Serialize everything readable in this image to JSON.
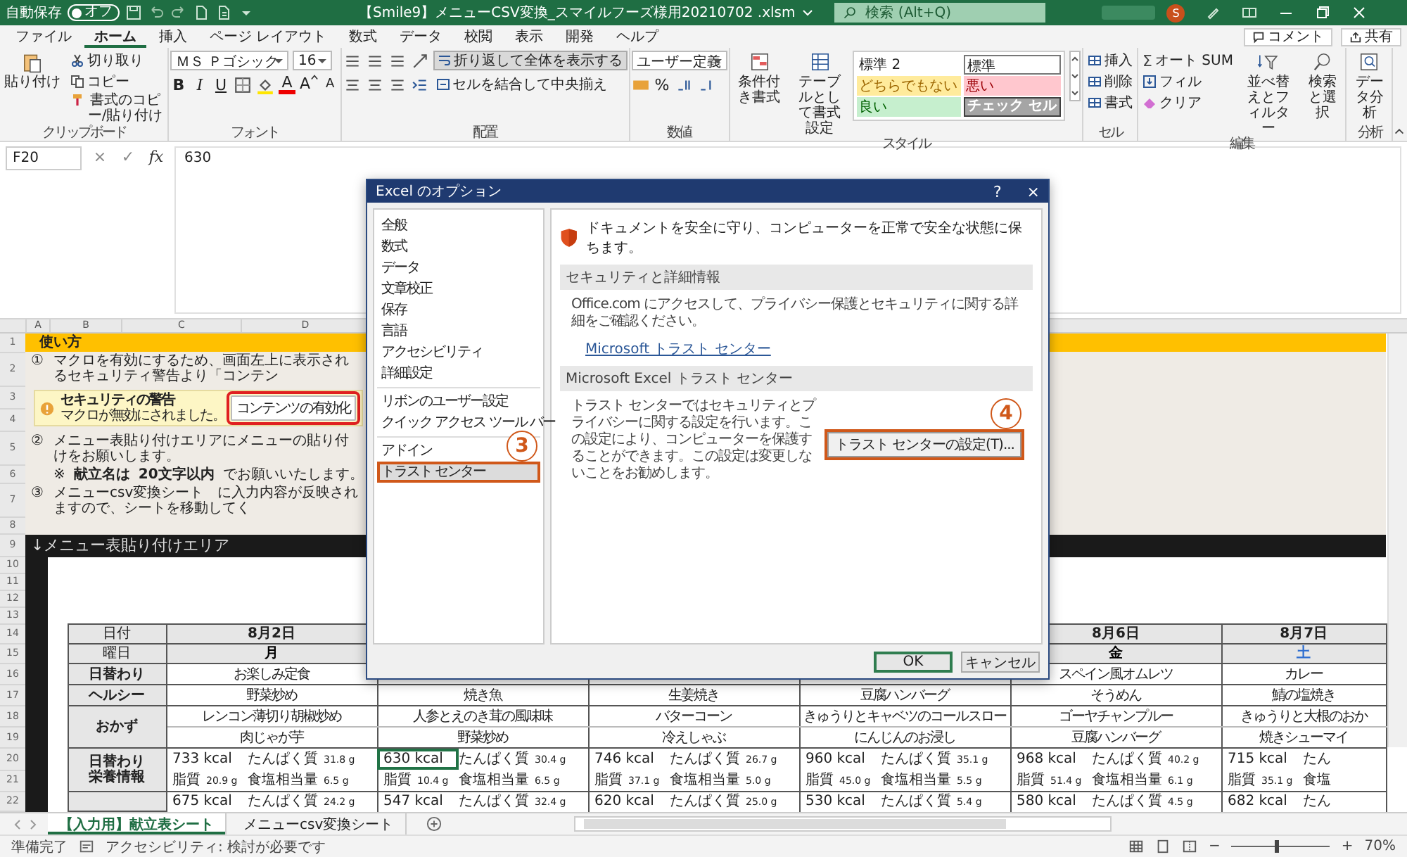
{
  "titlebar": {
    "autosave": "自動保存",
    "autosave_on": false,
    "toggle": "オフ",
    "title": "【Smile9】メニューCSV変換_スマイルフーズ様用20210702 .xlsm",
    "search": "検索 (Alt+Q)",
    "avatar": "S"
  },
  "menu": {
    "tabs": [
      {
        "label": "ファイル",
        "selected": false
      },
      {
        "label": "ホーム",
        "selected": true
      },
      {
        "label": "挿入",
        "selected": false
      },
      {
        "label": "ページ レイアウト",
        "selected": false
      },
      {
        "label": "数式",
        "selected": false
      },
      {
        "label": "データ",
        "selected": false
      },
      {
        "label": "校閲",
        "selected": false
      },
      {
        "label": "表示",
        "selected": false
      },
      {
        "label": "開発",
        "selected": false
      },
      {
        "label": "ヘルプ",
        "selected": false
      }
    ],
    "comment": "コメント",
    "share": "共有"
  },
  "ribbon": {
    "clipboard": {
      "paste": "貼り付け",
      "cut": "切り取り",
      "copy": "コピー",
      "painter": "書式のコピー/貼り付け",
      "label": "クリップボード"
    },
    "font": {
      "name": "ＭＳ Ｐゴシック",
      "size": "16",
      "grow": "A",
      "shrink": "A",
      "bold": "B",
      "italic": "I",
      "underline": "U",
      "color_letter": "A",
      "label": "フォント"
    },
    "alignment": {
      "wrap": "折り返して全体を表示する",
      "wrap_on": true,
      "merge": "セルを結合して中央揃え",
      "label": "配置"
    },
    "number": {
      "format": "ユーザー定義",
      "percent": "%",
      "label": "数値"
    },
    "styles": {
      "conditional": "条件付き書式",
      "table": "テーブルとして書式設定",
      "gallery": [
        {
          "name": "標準 2",
          "kind": "plain"
        },
        {
          "name": "標準",
          "kind": "outlined"
        },
        {
          "name": "どちらでもない",
          "kind": "neutral"
        },
        {
          "name": "悪い",
          "kind": "bad"
        },
        {
          "name": "良い",
          "kind": "good"
        },
        {
          "name": "チェック セル",
          "kind": "check"
        }
      ],
      "label": "スタイル"
    },
    "cells": {
      "buttons": [
        "挿入",
        "削除",
        "書式"
      ],
      "label": "セル"
    },
    "editing": {
      "sigma": "Σ",
      "autosum": "オート SUM",
      "fill": "フィル",
      "clear": "クリア",
      "sort": "並べ替えとフィルター",
      "find": "検索と選択",
      "label": "編集"
    },
    "analysis": {
      "button": "データ分析",
      "label": "分析"
    }
  },
  "formula": {
    "cell": "F20",
    "cancel": "×",
    "enter": "✓",
    "fx": "fx",
    "value": "630"
  },
  "sheet": {
    "columns": [
      "A",
      "B",
      "C",
      "D"
    ],
    "row_numbers": [
      "1",
      "2",
      "3",
      "4",
      "5",
      "6",
      "7",
      "8",
      "9",
      "10",
      "11",
      "12",
      "13",
      "14",
      "15",
      "16",
      "17",
      "18",
      "19",
      "20",
      "21",
      "22"
    ],
    "howto": "使い方",
    "steps": [
      {
        "number": "①",
        "text": "マクロを有効にするため、画面左上に表示されるセキュリティ警告より「コンテン"
      },
      {
        "number": "②",
        "text": "メニュー表貼り付けエリアにメニューの貼り付けをお願いします。"
      },
      {
        "number": "③",
        "text": "メニューcsv変換シート　に入力内容が反映されますので、シートを移動してく"
      }
    ],
    "note": [
      {
        "text": "※",
        "bold": false
      },
      {
        "text": "献立名は",
        "bold": true
      },
      {
        "text": "20文字以内",
        "bold": true
      },
      {
        "text": "でお願いいたします。",
        "bold": false
      }
    ],
    "security": {
      "title": "セキュリティの警告",
      "message": "マクロが無効にされました。",
      "button": "コンテンツの有効化",
      "highlighted": true
    },
    "paste_area": "↓メニュー表貼り付けエリア"
  },
  "table": {
    "date_row": {
      "label": "日付",
      "cells": [
        "8月2日",
        null,
        null,
        null,
        "8月6日",
        "8月7日"
      ]
    },
    "weekday_row": {
      "label": "曜日",
      "cells": [
        {
          "text": "月",
          "color": "#000000"
        },
        null,
        null,
        null,
        {
          "text": "金",
          "color": "#000000"
        },
        {
          "text": "土",
          "color": "#2f6fd0"
        }
      ]
    },
    "menu_rows": [
      {
        "label": "日替わり",
        "cells": [
          "お楽しみ定食",
          null,
          null,
          null,
          "スペイン風オムレツ",
          "カレー"
        ]
      },
      {
        "label": "ヘルシー",
        "cells": [
          "野菜炒め",
          "焼き魚",
          "生姜焼き",
          "豆腐ハンバーグ",
          "そうめん",
          "鯖の塩焼き"
        ]
      }
    ],
    "side_row": {
      "label": "おかず",
      "lines": [
        [
          "レンコン薄切り胡椒炒め",
          "人参とえのき茸の風味味",
          "バターコーン",
          "きゅうりとキャベツのコールスロー",
          "ゴーヤチャンプルー",
          "きゅうりと大根のおか"
        ],
        [
          "肉じゃが芋",
          "野菜炒め",
          "冷えしゃぶ",
          "にんじんのお浸し",
          "豆腐ハンバーグ",
          "焼きシューマイ"
        ]
      ]
    },
    "nutrition_row": {
      "label_lines": [
        "日替わり",
        "栄養情報"
      ],
      "cells": [
        {
          "kcal": "733 kcal",
          "protein": {
            "label": "たんぱく質",
            "value": "31.8 g"
          },
          "fat": {
            "label": "脂質",
            "value": "20.9 g"
          },
          "salt": {
            "label": "食塩相当量",
            "value": "6.5 g"
          },
          "selected": false
        },
        {
          "kcal": "630 kcal",
          "protein": {
            "label": "たんぱく質",
            "value": "30.4 g"
          },
          "fat": {
            "label": "脂質",
            "value": "10.4 g"
          },
          "salt": {
            "label": "食塩相当量",
            "value": "6.5 g"
          },
          "selected": true
        },
        {
          "kcal": "746 kcal",
          "protein": {
            "label": "たんぱく質",
            "value": "26.7 g"
          },
          "fat": {
            "label": "脂質",
            "value": "37.1 g"
          },
          "salt": {
            "label": "食塩相当量",
            "value": "5.0 g"
          },
          "selected": false
        },
        {
          "kcal": "960 kcal",
          "protein": {
            "label": "たんぱく質",
            "value": "35.1 g"
          },
          "fat": {
            "label": "脂質",
            "value": "45.0 g"
          },
          "salt": {
            "label": "食塩相当量",
            "value": "5.5 g"
          },
          "selected": false
        },
        {
          "kcal": "968 kcal",
          "protein": {
            "label": "たんぱく質",
            "value": "40.2 g"
          },
          "fat": {
            "label": "脂質",
            "value": "51.4 g"
          },
          "salt": {
            "label": "食塩相当量",
            "value": "6.1 g"
          },
          "selected": false
        },
        {
          "kcal": "715 kcal",
          "protein": {
            "label": "たん"
          },
          "fat": {
            "label": "脂質",
            "value": "35.1 g"
          },
          "salt": {
            "label": "食塩"
          },
          "selected": false
        }
      ]
    },
    "next_row": {
      "cells": [
        {
          "kcal": "675 kcal",
          "protein": {
            "label": "たんぱく質",
            "value": "24.2 g"
          }
        },
        {
          "kcal": "547 kcal",
          "protein": {
            "label": "たんぱく質",
            "value": "32.4 g"
          }
        },
        {
          "kcal": "620 kcal",
          "protein": {
            "label": "たんぱく質",
            "value": "25.0 g"
          }
        },
        {
          "kcal": "530 kcal",
          "protein": {
            "label": "たんぱく質",
            "value": "5.4 g"
          }
        },
        {
          "kcal": "580 kcal",
          "protein": {
            "label": "たんぱく質",
            "value": "4.5 g"
          }
        },
        {
          "kcal": "682 kcal",
          "protein": {
            "label": "たん"
          }
        }
      ]
    }
  },
  "dialog": {
    "title": "Excel のオプション",
    "help": "?",
    "close": "×",
    "nav": [
      [
        {
          "label": "全般",
          "selected": false
        },
        {
          "label": "数式",
          "selected": false
        },
        {
          "label": "データ",
          "selected": false
        },
        {
          "label": "文章校正",
          "selected": false
        },
        {
          "label": "保存",
          "selected": false
        },
        {
          "label": "言語",
          "selected": false
        },
        {
          "label": "アクセシビリティ",
          "selected": false
        },
        {
          "label": "詳細設定",
          "selected": false
        }
      ],
      [
        {
          "label": "リボンのユーザー設定",
          "selected": false
        },
        {
          "label": "クイック アクセス ツール バー",
          "selected": false
        }
      ],
      [
        {
          "label": "アドイン",
          "selected": false
        },
        {
          "label": "トラスト センター",
          "selected": true,
          "callout": "3"
        }
      ]
    ],
    "intro": "ドキュメントを安全に守り、コンピューターを正常で安全な状態に保ちます。",
    "sections": [
      {
        "heading": "セキュリティと詳細情報",
        "text": "Office.com にアクセスして、プライバシー保護とセキュリティに関する詳細をご確認ください。",
        "link": "Microsoft トラスト センター"
      },
      {
        "heading": "Microsoft Excel トラスト センター",
        "text": "トラスト センターではセキュリティとプライバシーに関する設定を行います。この設定により、コンピューターを保護することができます。この設定は変更しないことをお勧めします。",
        "button": "トラスト センターの設定(T)...",
        "callout": "4"
      }
    ],
    "ok": "OK",
    "cancel": "キャンセル"
  },
  "sheet_tabs": [
    {
      "label": "【入力用】献立表シート",
      "selected": true
    },
    {
      "label": "メニューcsv変換シート",
      "selected": false
    }
  ],
  "status": {
    "ready": "準備完了",
    "accessibility": "アクセシビリティ: 検討が必要です",
    "zoom": {
      "level": 0.45,
      "reading": "70%"
    },
    "minus": "−",
    "plus": "+"
  }
}
